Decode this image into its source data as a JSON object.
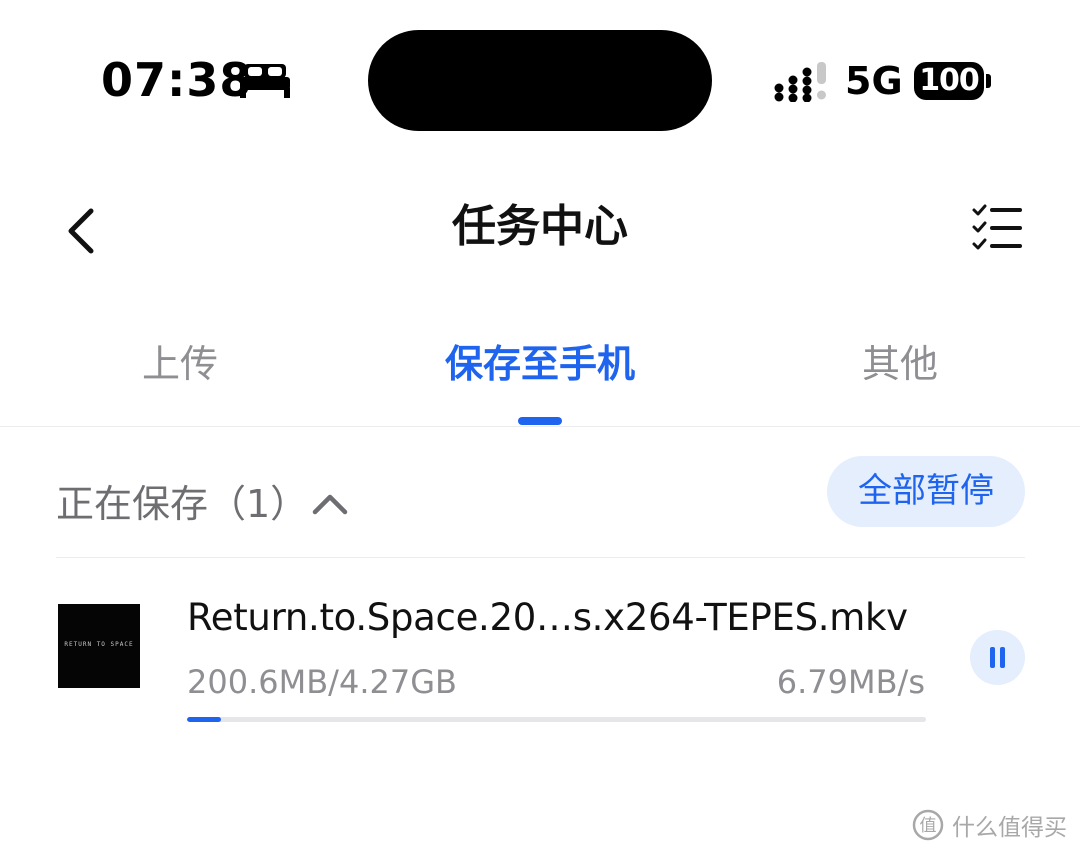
{
  "status_bar": {
    "time": "07:38",
    "network": "5G",
    "battery": "100"
  },
  "nav": {
    "title": "任务中心"
  },
  "tabs": [
    {
      "label": "上传",
      "active": false
    },
    {
      "label": "保存至手机",
      "active": true
    },
    {
      "label": "其他",
      "active": false
    }
  ],
  "section": {
    "title": "正在保存（1）",
    "pause_all_label": "全部暂停"
  },
  "task": {
    "file_name": "Return.to.Space.20…s.x264-TEPES.mkv",
    "thumbnail_text": "RETURN TO SPACE",
    "progress_text": "200.6MB/4.27GB",
    "speed": "6.79MB/s",
    "progress_fraction": 0.046
  },
  "watermark": {
    "text": "什么值得买"
  },
  "colors": {
    "accent": "#1f64ef",
    "accent_light": "#e4eefd",
    "secondary_text": "#8e8e93"
  }
}
